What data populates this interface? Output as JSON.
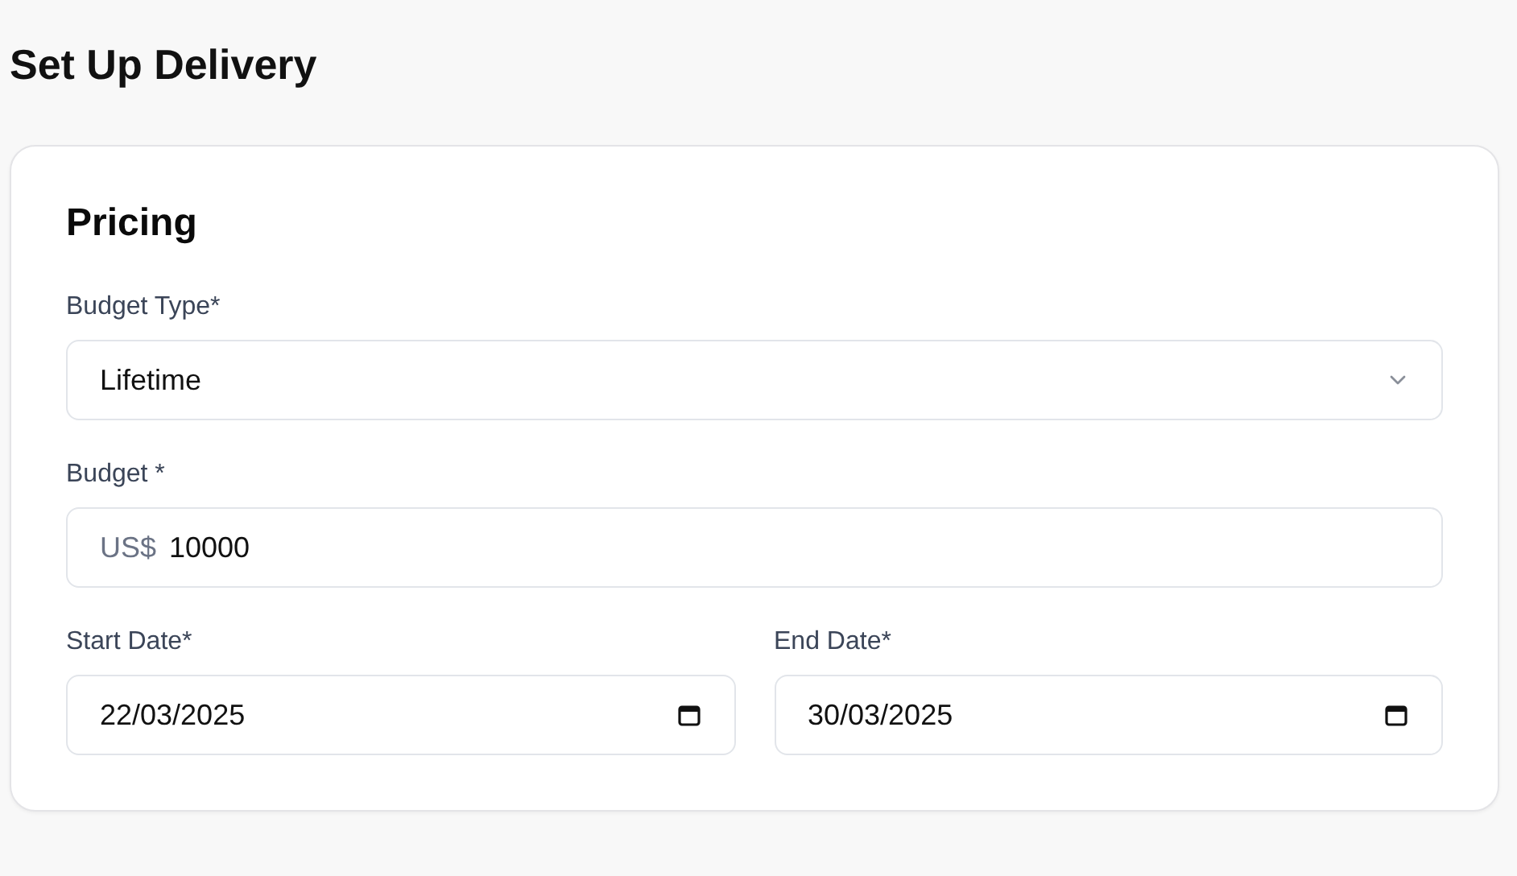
{
  "page_title": "Set Up Delivery",
  "card": {
    "heading": "Pricing",
    "rows": [
      {
        "fields": [
          {
            "kind": "select",
            "label": "Budget Type*",
            "value": "Lifetime"
          }
        ]
      },
      {
        "fields": [
          {
            "kind": "currency",
            "label": "Budget *",
            "prefix": "US$",
            "value": "10000"
          }
        ]
      },
      {
        "fields": [
          {
            "kind": "date",
            "label": "Start Date*",
            "value": "22/03/2025"
          },
          {
            "kind": "date",
            "label": "End Date*",
            "value": "30/03/2025"
          }
        ]
      }
    ]
  }
}
